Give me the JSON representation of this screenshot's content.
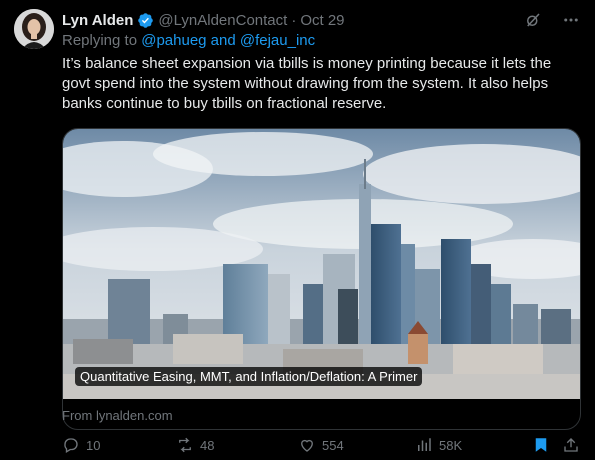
{
  "author": {
    "name": "Lyn Alden",
    "handle": "@LynAldenContact",
    "separator": "·",
    "date": "Oct 29"
  },
  "reply": {
    "prefix": "Replying to",
    "mentions": "@pahueg and @fejau_inc"
  },
  "tweet": {
    "text": "It’s balance sheet expansion via tbills is money printing because it lets the govt spend into the system without drawing from the system. It also helps banks continue to buy tbills on fractional reserve."
  },
  "card": {
    "title": "Quantitative Easing, MMT, and Inflation/Deflation: A Primer",
    "source": "From lynalden.com"
  },
  "actions": {
    "replies": "10",
    "reposts": "48",
    "likes": "554",
    "views": "58K"
  },
  "icons": {
    "verified": "verified-badge-icon",
    "grok": "grok-icon",
    "more": "more-icon",
    "reply": "reply-icon",
    "repost": "repost-icon",
    "like": "like-icon",
    "views": "views-icon",
    "bookmark": "bookmark-icon",
    "share": "share-icon"
  },
  "colors": {
    "background": "#000000",
    "text": "#e7e9ea",
    "muted": "#71767b",
    "accent": "#1d9bf0",
    "border": "#2f3336"
  }
}
